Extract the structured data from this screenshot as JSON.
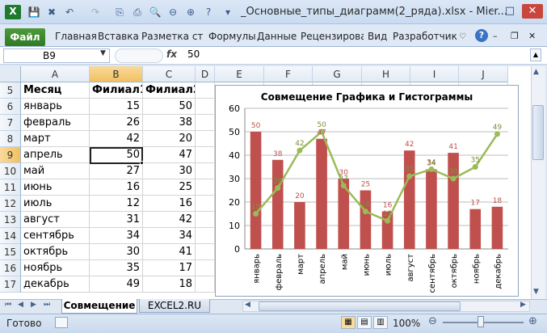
{
  "title": "_Основные_типы_диаграмм(2_ряда).xlsx - Micr...",
  "ribbon": {
    "file": "Файл",
    "tabs": [
      "Главная",
      "Вставка",
      "Разметка стра",
      "Формулы",
      "Данные",
      "Рецензирова",
      "Вид",
      "Разработчик"
    ]
  },
  "formula_bar": {
    "name_box": "B9",
    "fx": "fx",
    "value": "50"
  },
  "columns": [
    "A",
    "B",
    "C",
    "D",
    "E",
    "F",
    "G",
    "H",
    "I",
    "J"
  ],
  "rows": [
    "5",
    "6",
    "7",
    "8",
    "9",
    "10",
    "11",
    "12",
    "13",
    "14",
    "15",
    "16",
    "17"
  ],
  "table": {
    "headers": [
      "Месяц",
      "Филиал1",
      "Филиал2"
    ],
    "data": [
      [
        "январь",
        "15",
        "50"
      ],
      [
        "февраль",
        "26",
        "38"
      ],
      [
        "март",
        "42",
        "20"
      ],
      [
        "апрель",
        "50",
        "47"
      ],
      [
        "май",
        "27",
        "30"
      ],
      [
        "июнь",
        "16",
        "25"
      ],
      [
        "июль",
        "12",
        "16"
      ],
      [
        "август",
        "31",
        "42"
      ],
      [
        "сентябрь",
        "34",
        "34"
      ],
      [
        "октябрь",
        "30",
        "41"
      ],
      [
        "ноябрь",
        "35",
        "17"
      ],
      [
        "декабрь",
        "49",
        "18"
      ]
    ]
  },
  "chart_data": {
    "type": "bar",
    "title": "Совмещение Графика и Гистограммы",
    "categories": [
      "январь",
      "февраль",
      "март",
      "апрель",
      "май",
      "июнь",
      "июль",
      "август",
      "сентябрь",
      "октябрь",
      "ноябрь",
      "декабрь"
    ],
    "series": [
      {
        "type": "bar",
        "values": [
          50,
          38,
          20,
          47,
          30,
          25,
          16,
          42,
          34,
          41,
          17,
          18
        ],
        "color": "#c0504d"
      },
      {
        "type": "line",
        "values": [
          15,
          26,
          42,
          50,
          27,
          16,
          12,
          31,
          34,
          30,
          35,
          49
        ],
        "color": "#9bbb59"
      }
    ],
    "ylim": [
      0,
      60
    ],
    "yticks": [
      "0",
      "10",
      "20",
      "30",
      "40",
      "50",
      "60"
    ],
    "grid": true
  },
  "sheet_tabs": [
    "Совмещение",
    "EXCEL2.RU"
  ],
  "status": {
    "ready": "Готово",
    "zoom": "100%"
  },
  "colors": {
    "selection": "#f1c15f",
    "file_tab": "#2f7a24"
  }
}
